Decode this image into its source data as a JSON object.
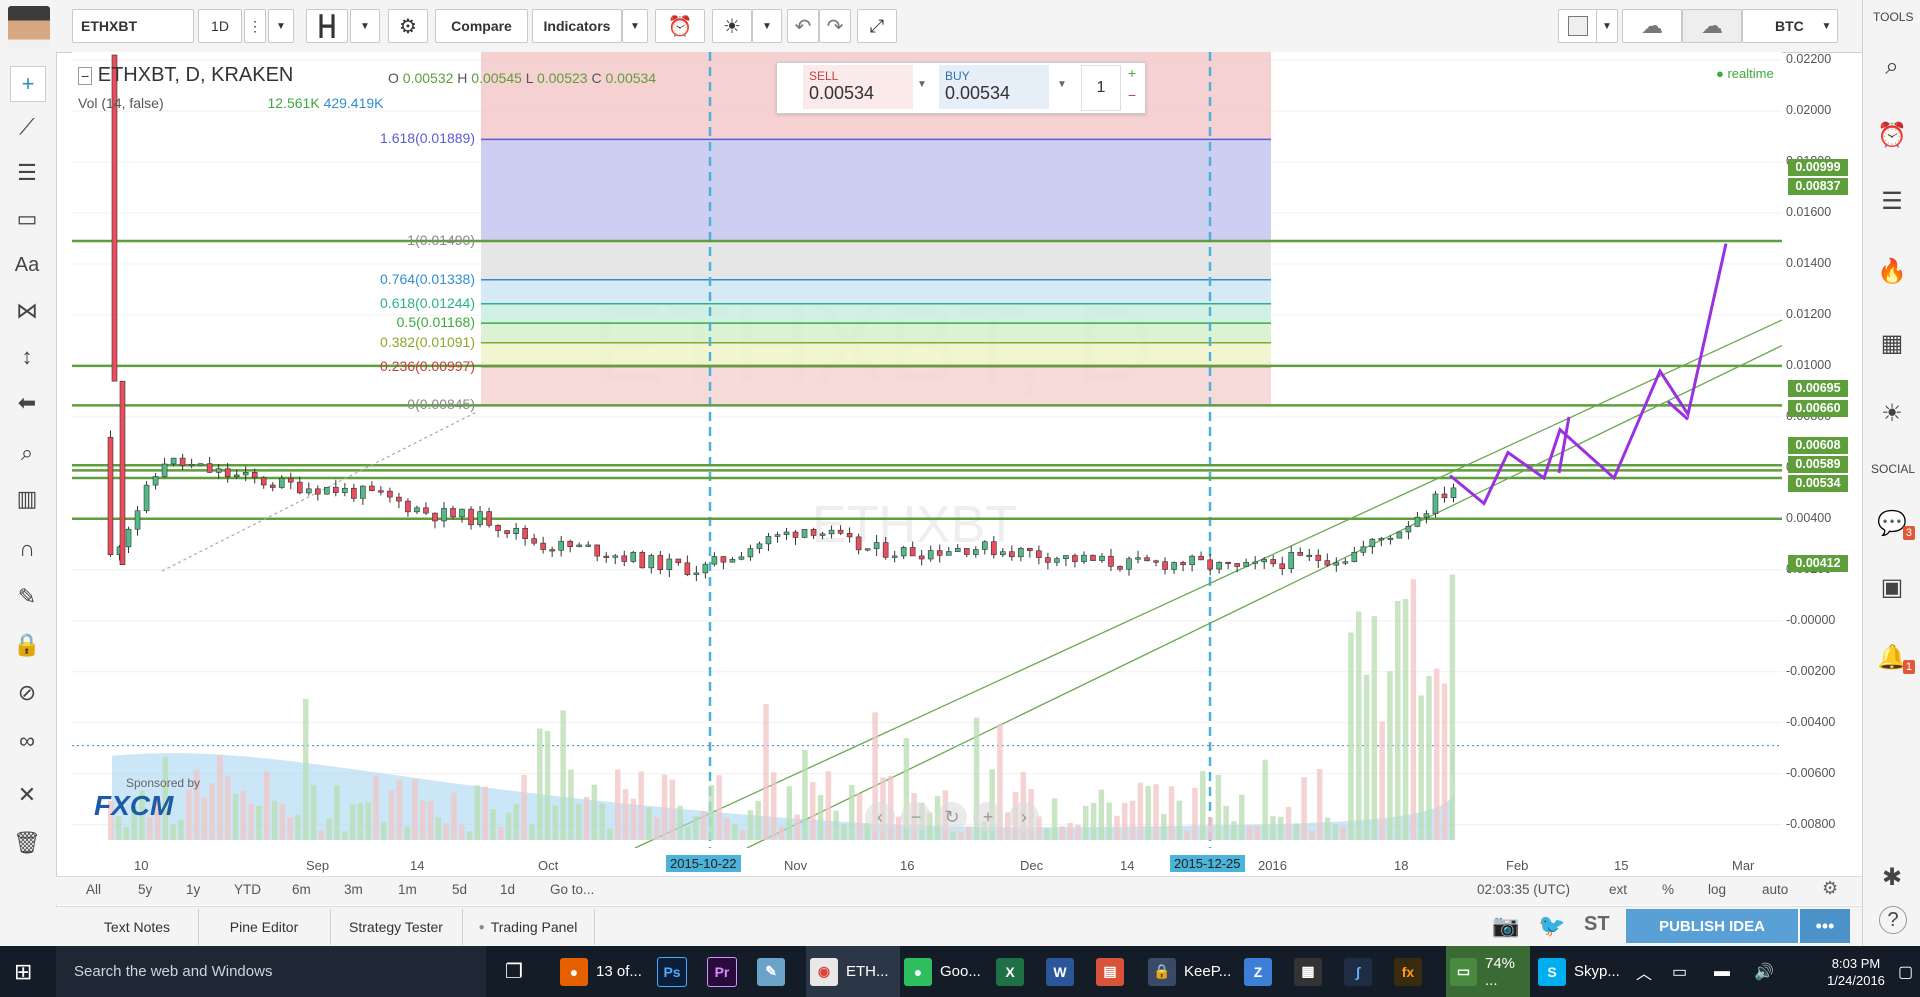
{
  "toolbar": {
    "symbol": "ETHXBT",
    "interval": "1D",
    "compare_label": "Compare",
    "indicators_label": "Indicators",
    "currency": "BTC"
  },
  "chart_header": {
    "title": "ETHXBT, D, KRAKEN",
    "o_label": "O",
    "o_value": "0.00532",
    "h_label": "H",
    "h_value": "0.00545",
    "l_label": "L",
    "l_value": "0.00523",
    "c_label": "C",
    "c_value": "0.00534",
    "vol_label": "Vol (14, false)",
    "vol_value1": "12.561K",
    "vol_value2": "429.419K",
    "realtime": "realtime"
  },
  "trade": {
    "sell_label": "SELL",
    "sell_price": "0.00534",
    "buy_label": "BUY",
    "buy_price": "0.00534",
    "quantity": "1"
  },
  "watermark": {
    "main": "ETHXBT, D",
    "sub": "ETHXBT"
  },
  "sponsor": {
    "label": "Sponsored by",
    "brand": "FXCM"
  },
  "fib_levels": [
    {
      "label": "1.618(0.01889)",
      "value": 0.01889,
      "color": "#5b5bd6"
    },
    {
      "label": "1(0.01490)",
      "value": 0.0149,
      "color": "#888888"
    },
    {
      "label": "0.764(0.01338)",
      "value": 0.01338,
      "color": "#2f8fd0"
    },
    {
      "label": "0.618(0.01244)",
      "value": 0.01244,
      "color": "#2bb08a"
    },
    {
      "label": "0.5(0.01168)",
      "value": 0.01168,
      "color": "#3caa3c"
    },
    {
      "label": "0.382(0.01091)",
      "value": 0.01091,
      "color": "#8aa82a"
    },
    {
      "label": "0.236(0.00997)",
      "value": 0.00997,
      "color": "#c04040"
    },
    {
      "label": "0(0.00845)",
      "value": 0.00845,
      "color": "#888888"
    }
  ],
  "price_axis": [
    "0.02200",
    "0.02000",
    "0.01800",
    "0.01600",
    "0.01400",
    "0.01200",
    "0.01000",
    "0.00800",
    "0.00600",
    "0.00400",
    "0.00200",
    "-0.00000",
    "-0.00200",
    "-0.00400",
    "-0.00600",
    "-0.00800"
  ],
  "price_tags": [
    {
      "label": "0.00999",
      "value": 0.01782
    },
    {
      "label": "0.00837",
      "value": 0.01707
    },
    {
      "label": "0.00695",
      "value": 0.00915
    },
    {
      "label": "0.00660",
      "value": 0.00835
    },
    {
      "label": "0.00608",
      "value": 0.0069
    },
    {
      "label": "0.00589",
      "value": 0.00615
    },
    {
      "label": "0.00534",
      "value": 0.0054
    },
    {
      "label": "0.00412",
      "value": 0.00225
    }
  ],
  "time_axis": [
    "10",
    "Sep",
    "14",
    "Oct",
    "2015-10-22",
    "Nov",
    "16",
    "Dec",
    "14",
    "2015-12-25",
    "2016",
    "18",
    "Feb",
    "15",
    "Mar"
  ],
  "range_buttons": [
    "All",
    "5y",
    "1y",
    "YTD",
    "6m",
    "3m",
    "1m",
    "5d",
    "1d",
    "Go to..."
  ],
  "range_right": {
    "clock": "02:03:35 (UTC)",
    "ext": "ext",
    "pct": "%",
    "log": "log",
    "auto": "auto"
  },
  "panels": [
    "Text Notes",
    "Pine Editor",
    "Strategy Tester",
    "Trading Panel"
  ],
  "publish_label": "PUBLISH IDEA",
  "right_panel": {
    "tools": "TOOLS",
    "social": "SOCIAL",
    "chat_badge": "3",
    "alert_badge": "1"
  },
  "taskbar": {
    "search": "Search the web and Windows",
    "apps": [
      "13 of...",
      "ETH...",
      "Goo...",
      "KeeP...",
      "74% ...",
      "Skyp..."
    ],
    "time": "8:03 PM",
    "date": "1/24/2016"
  },
  "chart_data": {
    "type": "candlestick",
    "title": "ETHXBT, D, KRAKEN",
    "xlabel": "",
    "ylabel": "",
    "ylim": [
      -0.0088,
      0.0222
    ],
    "x": [
      "2015-08-08",
      "2015-08-15",
      "2015-08-22",
      "2015-08-29",
      "2015-09-05",
      "2015-09-12",
      "2015-09-19",
      "2015-09-26",
      "2015-10-03",
      "2015-10-10",
      "2015-10-17",
      "2015-10-22",
      "2015-10-27",
      "2015-11-01",
      "2015-11-08",
      "2015-11-15",
      "2015-11-22",
      "2015-11-29",
      "2015-12-06",
      "2015-12-13",
      "2015-12-20",
      "2015-12-25",
      "2016-01-01",
      "2016-01-08",
      "2016-01-15",
      "2016-01-22"
    ],
    "close": [
      0.0025,
      0.0063,
      0.0058,
      0.0054,
      0.0052,
      0.0049,
      0.0042,
      0.004,
      0.003,
      0.0028,
      0.0023,
      0.002,
      0.003,
      0.0037,
      0.0028,
      0.0027,
      0.0029,
      0.0027,
      0.0024,
      0.0022,
      0.0023,
      0.002,
      0.0024,
      0.0025,
      0.0036,
      0.0053
    ],
    "resistance_lines": [
      0.0149,
      0.01,
      0.00845,
      0.0061,
      0.0059,
      0.0056,
      0.004
    ],
    "projection": [
      [
        0.0055,
        0.004
      ],
      [
        0.0066,
        0.0055
      ],
      [
        0.008,
        0.006
      ],
      [
        0.0108,
        0.008
      ],
      [
        0.0149
      ]
    ]
  }
}
